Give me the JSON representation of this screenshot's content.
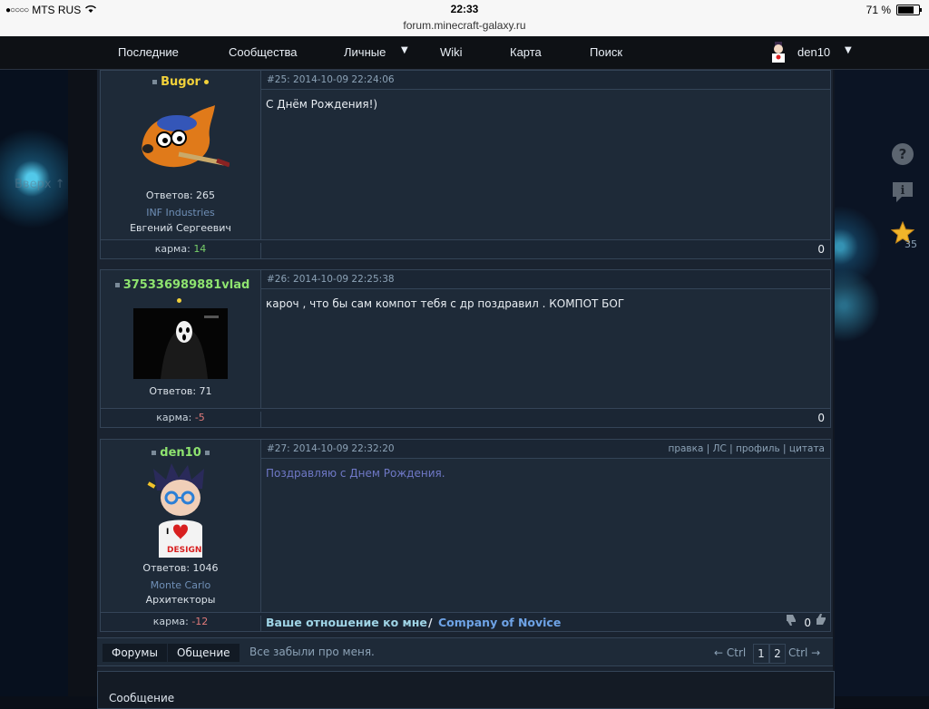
{
  "statusbar": {
    "carrier": "MTS RUS",
    "time": "22:33",
    "url": "forum.minecraft-galaxy.ru",
    "battery": "71 %",
    "battery_level": 0.71
  },
  "nav": {
    "items": [
      "Последние",
      "Сообщества",
      "Личные",
      "Wiki",
      "Карта",
      "Поиск"
    ],
    "user": "den10"
  },
  "ghost": {
    "up_text": "Вверх ↑"
  },
  "posts": [
    {
      "username": "Bugor",
      "username_color": "#f2d13a",
      "meta": "#25: 2014-10-09 22:24:06",
      "text": "С Днём Рождения!)",
      "replies": "Ответов: 265",
      "group": "INF Industries",
      "realname": "Евгений Сергеевич",
      "karma_label": "карма:",
      "karma": "14",
      "score": "0"
    },
    {
      "username": "375336989881vlad",
      "username_color": "#8ee36f",
      "meta": "#26: 2014-10-09 22:25:38",
      "text": "кароч , что бы сам компот тебя с др поздравил . КОМПОТ БОГ",
      "replies": "Ответов: 71",
      "karma_label": "карма:",
      "karma": "-5",
      "score": "0"
    },
    {
      "username": "den10",
      "username_color": "#8ee36f",
      "meta": "#27: 2014-10-09 22:32:20",
      "actions": "правка | ЛС | профиль | цитата",
      "text": "Поздравляю с Днем Рождения.",
      "replies": "Ответов: 1046",
      "group": "Monte Carlo",
      "role": "Архитекторы",
      "karma_label": "карма:",
      "karma": "-12",
      "attitude": "Ваше отношение ко мне",
      "slash": "/",
      "company": "Company of Novice",
      "score": "0"
    }
  ],
  "footer": {
    "tab_forums": "Форумы",
    "tab_chat": "Общение",
    "crumb": "Все забыли про меня.",
    "prev": "← Ctrl",
    "page1": "1",
    "page2": "2",
    "next": "Ctrl →",
    "reply_label": "Сообщение"
  },
  "side": {
    "star_count": "35"
  }
}
